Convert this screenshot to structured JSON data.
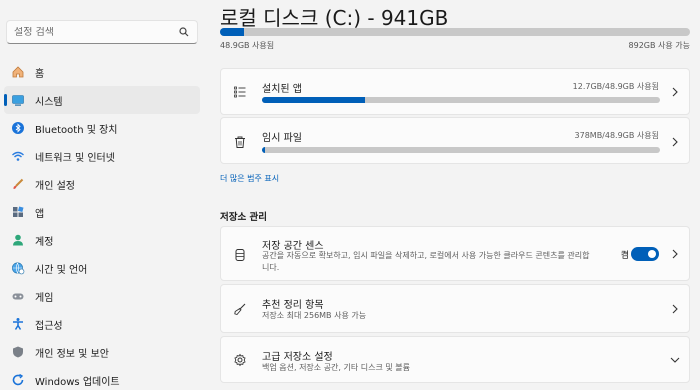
{
  "search": {
    "placeholder": "설정 검색"
  },
  "sidebar": {
    "items": [
      {
        "label": "홈",
        "icon": "home-icon"
      },
      {
        "label": "시스템",
        "icon": "system-icon",
        "selected": true
      },
      {
        "label": "Bluetooth 및 장치",
        "icon": "bluetooth-icon"
      },
      {
        "label": "네트워크 및 인터넷",
        "icon": "wifi-icon"
      },
      {
        "label": "개인 설정",
        "icon": "brush-icon"
      },
      {
        "label": "앱",
        "icon": "apps-icon"
      },
      {
        "label": "계정",
        "icon": "account-icon"
      },
      {
        "label": "시간 및 언어",
        "icon": "globe-clock-icon"
      },
      {
        "label": "게임",
        "icon": "gamepad-icon"
      },
      {
        "label": "접근성",
        "icon": "accessibility-icon"
      },
      {
        "label": "개인 정보 및 보안",
        "icon": "shield-icon"
      },
      {
        "label": "Windows 업데이트",
        "icon": "update-icon"
      }
    ]
  },
  "main": {
    "title": "로컬 디스크 (C:) - 941GB",
    "drive": {
      "used_label": "48.9GB 사용됨",
      "free_label": "892GB 사용 가능",
      "used_fraction": 0.052
    },
    "categories": [
      {
        "title": "설치된 앱",
        "usage": "12.7GB/48.9GB 사용됨",
        "fraction": 0.26,
        "icon": "list-icon"
      },
      {
        "title": "임시 파일",
        "usage": "378MB/48.9GB 사용됨",
        "fraction": 0.008,
        "icon": "trash-icon"
      }
    ],
    "more_link": "더 많은 범주 표시",
    "section_title": "저장소 관리",
    "storage_sense": {
      "title": "저장 공간 센스",
      "description": "공간을 자동으로 확보하고, 임시 파일을 삭제하고, 로컬에서 사용 가능한 클라우드 콘텐츠를 관리합니다.",
      "toggle_label": "켬",
      "toggle_on": true,
      "icon": "drive-stack-icon"
    },
    "cleanup": {
      "title": "추천 정리 항목",
      "description": "저장소 최대 256MB 사용 가능",
      "icon": "broom-icon"
    },
    "advanced": {
      "title": "고급 저장소 설정",
      "description": "백업 옵션, 저장소 공간, 기타 디스크 및 볼륨",
      "icon": "gear-icon"
    }
  },
  "colors": {
    "accent": "#005fb8",
    "track": "#c8c8c8",
    "background": "#f3f3f3",
    "card": "#fbfbfb"
  }
}
